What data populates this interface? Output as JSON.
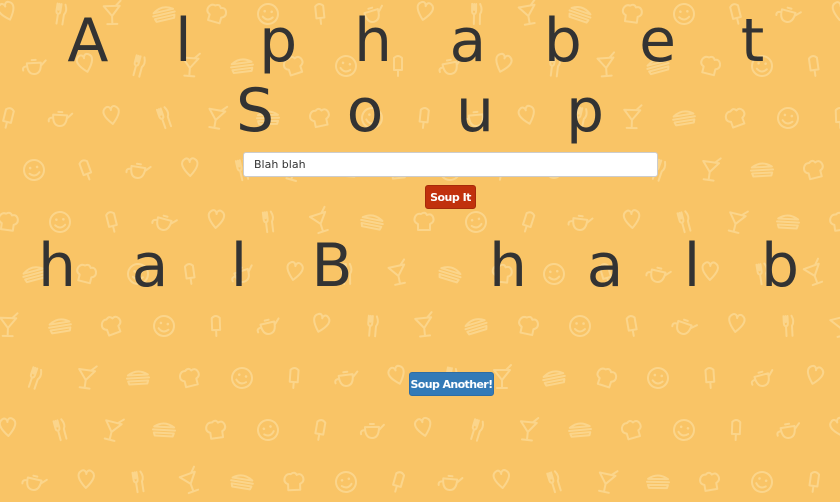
{
  "app": {
    "title_line1": [
      "A",
      "l",
      "p",
      "h",
      "a",
      "b",
      "e",
      "t"
    ],
    "title_line2": [
      "S",
      "o",
      "u",
      "p"
    ]
  },
  "form": {
    "input_value": "Blah blah",
    "input_placeholder": "",
    "soup_button_label": "Soup It"
  },
  "result": {
    "chars": [
      "h",
      "a",
      "l",
      "B",
      "",
      "h",
      "a",
      "l",
      "b"
    ]
  },
  "actions": {
    "again_button_label": "Soup Another!"
  },
  "theme": {
    "background": "#f9c466",
    "pattern": "#fbd58b",
    "text": "#333333",
    "soup_button": "#c1310d",
    "again_button": "#337ab7"
  },
  "background_icons": [
    "heart-icon",
    "smiley-icon",
    "cocktail-icon",
    "teapot-icon",
    "chef-hat-icon",
    "fork-knife-icon",
    "popsicle-icon",
    "sandwich-icon"
  ]
}
